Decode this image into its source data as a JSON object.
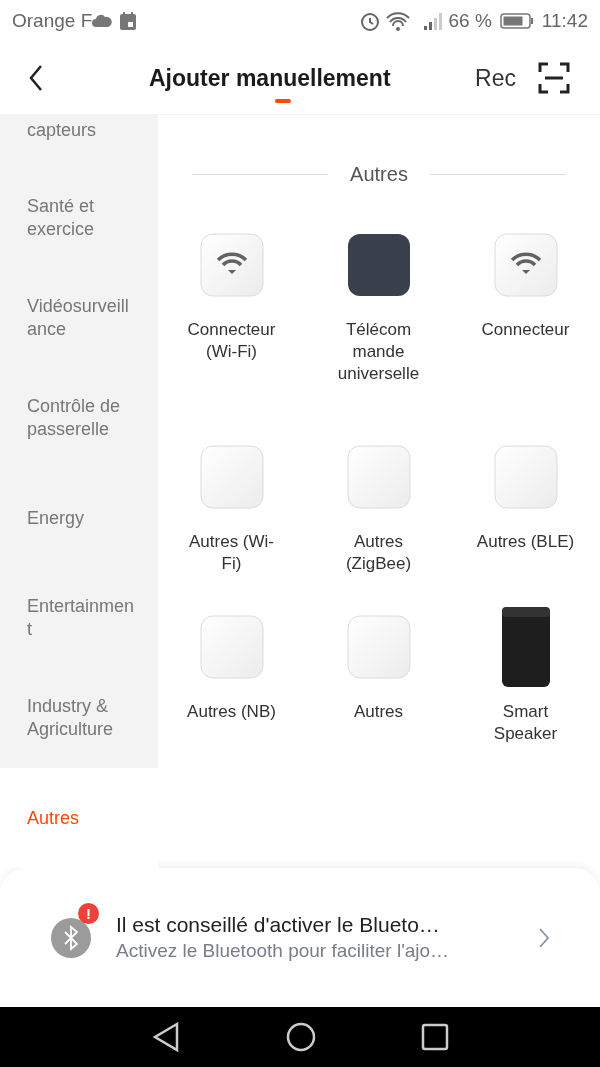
{
  "status_bar": {
    "carrier": "Orange F",
    "battery_text": "66 %",
    "time": "11:42"
  },
  "header": {
    "title": "Ajouter manuellement",
    "action": "Rec"
  },
  "sidebar": {
    "items": [
      {
        "label": "capteurs",
        "selected": false
      },
      {
        "label": "Santé et exercice",
        "selected": false
      },
      {
        "label": "Vidéosurveillance",
        "selected": false
      },
      {
        "label": "Contrôle de passerelle",
        "selected": false
      },
      {
        "label": "Energy",
        "selected": false
      },
      {
        "label": "Entertainment",
        "selected": false
      },
      {
        "label": "Industry & Agriculture",
        "selected": false
      },
      {
        "label": "Autres",
        "selected": true
      }
    ]
  },
  "section": {
    "title": "Autres",
    "devices": [
      {
        "label": "Connecteur (Wi-Fi)",
        "kind": "wifi"
      },
      {
        "label": "Télécom mande universelle",
        "kind": "dark"
      },
      {
        "label": "Connecteur",
        "kind": "wifi"
      },
      {
        "label": "Autres (Wi-Fi)",
        "kind": "plain"
      },
      {
        "label": "Autres (ZigBee)",
        "kind": "plain"
      },
      {
        "label": "Autres (BLE)",
        "kind": "plain"
      },
      {
        "label": "Autres (NB)",
        "kind": "plain"
      },
      {
        "label": "Autres",
        "kind": "plain"
      },
      {
        "label": "Smart Speaker",
        "kind": "speaker"
      }
    ]
  },
  "bluetooth_card": {
    "badge": "!",
    "title": "Il est conseillé d'activer le Blueto…",
    "subtitle": "Activez le Bluetooth pour faciliter l'ajo…"
  }
}
